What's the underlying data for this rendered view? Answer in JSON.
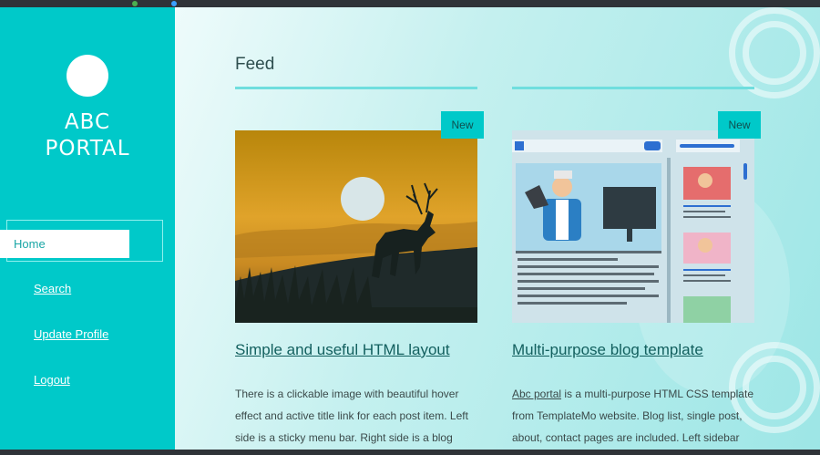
{
  "sidebar": {
    "brand_line1": "ABC",
    "brand_line2": "PORTAL",
    "nav": {
      "home": "Home",
      "search": "Search",
      "update_profile": "Update Profile",
      "logout": "Logout"
    }
  },
  "main": {
    "heading": "Feed",
    "posts": [
      {
        "badge": "New",
        "title": "Simple and useful HTML layout",
        "text": "There is a clickable image with beautiful hover effect and active title link for each post item. Left side is a sticky menu bar. Right side is a blog content that will"
      },
      {
        "badge": "New",
        "title": "Multi-purpose blog template",
        "text_link": "Abc portal",
        "text_rest": " is a multi-purpose HTML CSS template from TemplateMo website. Blog list, single post, about, contact pages are included. Left sidebar fixed"
      }
    ]
  },
  "colors": {
    "accent": "#00c9c9",
    "sidebar_bg": "#00c9c9",
    "heading_text": "#2f4f4f",
    "link_text": "#13605f"
  },
  "icons": {
    "logo": "circle-logo-icon",
    "post1_image": "deer-sunset-image",
    "post2_image": "blog-template-illustration"
  }
}
